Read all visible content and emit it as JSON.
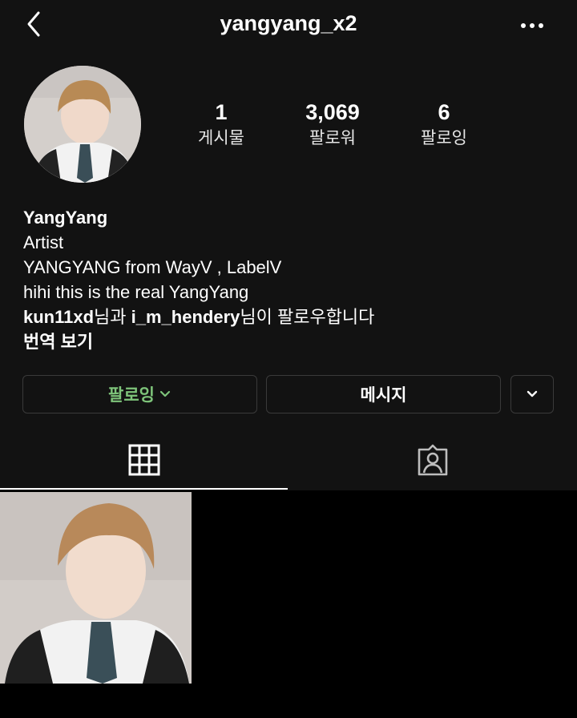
{
  "header": {
    "username": "yangyang_x2"
  },
  "stats": [
    {
      "value": "1",
      "label": "게시물"
    },
    {
      "value": "3,069",
      "label": "팔로워"
    },
    {
      "value": "6",
      "label": "팔로잉"
    }
  ],
  "bio": {
    "name": "YangYang",
    "category": "Artist",
    "line1": "YANGYANG from WayV , LabelV",
    "line2": "hihi this is the real YangYang",
    "followed_by_user1": "kun11xd",
    "followed_by_mid": "님과 ",
    "followed_by_user2": "i_m_hendery",
    "followed_by_end": "님이 팔로우합니다",
    "translate": "번역 보기"
  },
  "actions": {
    "following_label": "팔로잉",
    "message_label": "메시지"
  },
  "colors": {
    "background": "#121212",
    "following_text": "#7ec47a",
    "border": "#3a3a3a"
  },
  "icons": [
    "back-icon",
    "more-icon",
    "chevron-down-icon",
    "grid-icon",
    "tagged-icon"
  ]
}
